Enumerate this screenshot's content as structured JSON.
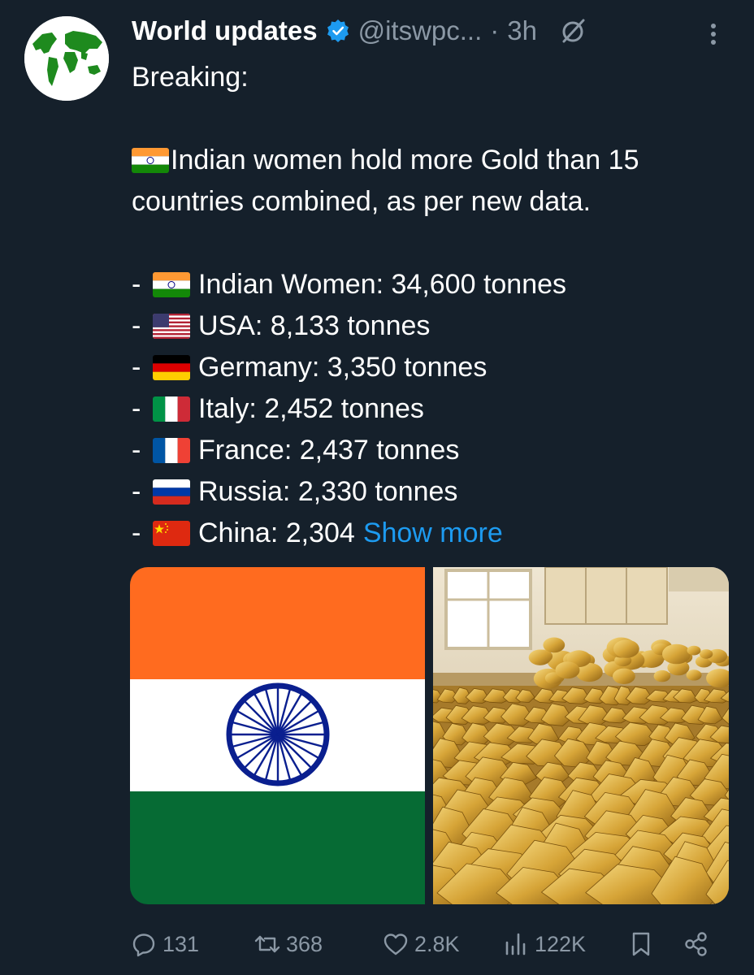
{
  "tweet": {
    "author_name": "World updates",
    "handle": "@itswpc...",
    "separator": "·",
    "time": "3h",
    "lines": {
      "breaking": "Breaking:",
      "intro_1": "Indian women hold more Gold than 15",
      "intro_2": "countries combined, as per new data."
    },
    "list": [
      {
        "dash": "-",
        "flag": "india-flag-icon",
        "text": "Indian Women: 34,600 tonnes"
      },
      {
        "dash": "-",
        "flag": "usa-flag-icon",
        "text": "USA: 8,133 tonnes"
      },
      {
        "dash": "-",
        "flag": "germany-flag-icon",
        "text": "Germany: 3,350 tonnes"
      },
      {
        "dash": "-",
        "flag": "italy-flag-icon",
        "text": "Italy: 2,452 tonnes"
      },
      {
        "dash": "-",
        "flag": "france-flag-icon",
        "text": "France: 2,437 tonnes"
      },
      {
        "dash": "-",
        "flag": "russia-flag-icon",
        "text": "Russia: 2,330 tonnes"
      },
      {
        "dash": "-",
        "flag": "china-flag-icon",
        "text": "China: 2,304"
      }
    ],
    "show_more": "Show more"
  },
  "actions": {
    "replies": "131",
    "reposts": "368",
    "likes": "2.8K",
    "views": "122K"
  },
  "icons": {
    "verified": "verified-badge-icon",
    "grok": "grok-icon",
    "more": "more-vertical-icon",
    "reply": "reply-icon",
    "repost": "repost-icon",
    "like": "heart-icon",
    "views": "views-icon",
    "bookmark": "bookmark-icon",
    "share": "share-icon"
  },
  "colors": {
    "background": "#15202b",
    "text": "#ffffff",
    "muted": "#8b98a5",
    "link": "#1d9bf0",
    "verified": "#1d9bf0"
  }
}
